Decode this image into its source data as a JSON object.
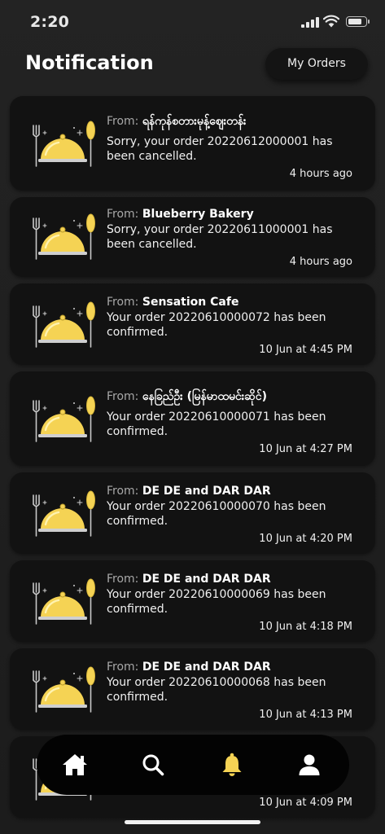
{
  "status_bar": {
    "time": "2:20"
  },
  "header": {
    "title": "Notification",
    "my_orders_label": "My Orders"
  },
  "notifications": [
    {
      "from_prefix": "From:",
      "sender": "ရန်ကုန်စတားမုန့်ဈေးတန်း",
      "message": "Sorry, your order 20220612000001 has been cancelled.",
      "time": "4 hours ago"
    },
    {
      "from_prefix": "From:",
      "sender": "Blueberry Bakery",
      "message": "Sorry, your order 20220611000001 has been cancelled.",
      "time": "4 hours ago"
    },
    {
      "from_prefix": "From:",
      "sender": "Sensation Cafe",
      "message": "Your order 20220610000072 has been confirmed.",
      "time": "10 Jun at 4:45 PM"
    },
    {
      "from_prefix": "From:",
      "sender": "နေခြည်ဦး (မြန်မာထမင်းဆိုင်)",
      "message": "Your order 20220610000071 has been confirmed.",
      "time": "10 Jun at 4:27 PM"
    },
    {
      "from_prefix": "From:",
      "sender": "DE DE and DAR DAR",
      "message": "Your order 20220610000070 has been confirmed.",
      "time": "10 Jun at 4:20 PM"
    },
    {
      "from_prefix": "From:",
      "sender": "DE DE and DAR DAR",
      "message": "Your order 20220610000069 has been confirmed.",
      "time": "10 Jun at 4:18 PM"
    },
    {
      "from_prefix": "From:",
      "sender": "DE DE and DAR DAR",
      "message": "Your order 20220610000068 has been confirmed.",
      "time": "10 Jun at 4:13 PM"
    },
    {
      "from_prefix": "",
      "sender": "",
      "message": "",
      "time": "10 Jun at 4:09 PM"
    }
  ],
  "bottom_nav": {
    "items": [
      {
        "icon": "home-icon"
      },
      {
        "icon": "search-icon"
      },
      {
        "icon": "bell-icon",
        "active": true
      },
      {
        "icon": "user-icon"
      }
    ]
  },
  "colors": {
    "accent": "#f5d354",
    "card": "#121212",
    "background": "#1d1d1d",
    "nav": "#030303"
  }
}
